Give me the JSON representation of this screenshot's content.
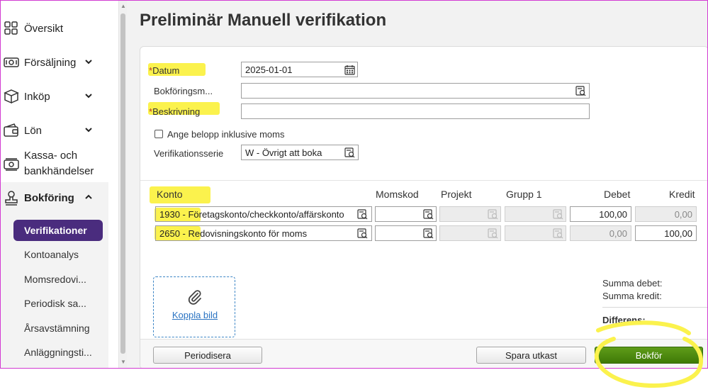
{
  "sidebar": {
    "items": [
      {
        "label": "Översikt",
        "icon": "grid-icon"
      },
      {
        "label": "Försäljning",
        "icon": "cash-icon"
      },
      {
        "label": "Inköp",
        "icon": "box-icon"
      },
      {
        "label": "Lön",
        "icon": "wallet-icon"
      },
      {
        "label_line1": "Kassa- och",
        "label_line2": "bankhändelser",
        "icon": "bank-icon"
      }
    ],
    "bokforing": {
      "label": "Bokföring",
      "icon": "stamp-icon",
      "subitems": [
        "Verifikationer",
        "Kontoanalys",
        "Momsredovi...",
        "Periodisk sa...",
        "Årsavstämning",
        "Anläggningsti..."
      ]
    }
  },
  "page": {
    "title": "Preliminär Manuell verifikation"
  },
  "form": {
    "datum_label": "Datum",
    "datum_value": "2025-01-01",
    "bokforingsmall_label": "Bokföringsm...",
    "bokforingsmall_value": "",
    "beskrivning_label": "Beskrivning",
    "beskrivning_value": "",
    "moms_checkbox_label": "Ange belopp inklusive moms",
    "moms_checkbox_checked": false,
    "verifikationsserie_label": "Verifikationsserie",
    "verifikationsserie_value": "W - Övrigt att boka",
    "required_marker": "*"
  },
  "table": {
    "headers": [
      "Konto",
      "Momskod",
      "Projekt",
      "Grupp 1",
      "Debet",
      "Kredit"
    ],
    "rows": [
      {
        "konto": "1930 - Företagskonto/checkkonto/affärskonto",
        "momskod": "",
        "projekt": "",
        "grupp1": "",
        "debet": "100,00",
        "kredit": "0,00"
      },
      {
        "konto": "2650 - Redovisningskonto för moms",
        "momskod": "",
        "projekt": "",
        "grupp1": "",
        "debet": "0,00",
        "kredit": "100,00"
      }
    ]
  },
  "attachment": {
    "link": "Koppla bild",
    "icon": "paperclip-icon"
  },
  "summary": {
    "debet_label": "Summa debet:",
    "kredit_label": "Summa kredit:",
    "diff_label": "Differens:"
  },
  "footer": {
    "periodisera": "Periodisera",
    "spara": "Spara utkast",
    "bokfor": "Bokför"
  },
  "colors": {
    "accent": "#4a2c7e",
    "primary_button": "#4a8a10",
    "highlight": "#fbf24d",
    "link": "#2a73c2"
  }
}
